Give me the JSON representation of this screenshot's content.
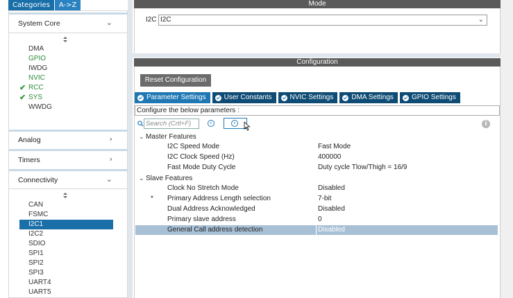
{
  "left_tabs": [
    "Categories",
    "A->Z"
  ],
  "categories": [
    {
      "label": "System Core",
      "chevron": "chevron-down-icon"
    },
    {
      "label": "Analog",
      "chevron": "chevron-right-icon"
    },
    {
      "label": "Timers",
      "chevron": "chevron-right-icon"
    },
    {
      "label": "Connectivity",
      "chevron": "chevron-down-icon"
    }
  ],
  "system_core_items": [
    {
      "label": "DMA",
      "status": "none"
    },
    {
      "label": "GPIO",
      "status": "configured"
    },
    {
      "label": "IWDG",
      "status": "none"
    },
    {
      "label": "NVIC",
      "status": "configured"
    },
    {
      "label": "RCC",
      "status": "checked"
    },
    {
      "label": "SYS",
      "status": "checked"
    },
    {
      "label": "WWDG",
      "status": "none"
    }
  ],
  "connectivity_items": [
    {
      "label": "CAN"
    },
    {
      "label": "FSMC"
    },
    {
      "label": "I2C1",
      "selected": true
    },
    {
      "label": "I2C2"
    },
    {
      "label": "SDIO"
    },
    {
      "label": "SPI1"
    },
    {
      "label": "SPI2"
    },
    {
      "label": "SPI3"
    },
    {
      "label": "UART4"
    },
    {
      "label": "UART5"
    }
  ],
  "mode": {
    "title": "Mode",
    "field_label": "I2C",
    "field_value": "I2C"
  },
  "configuration": {
    "title": "Configuration",
    "reset_label": "Reset Configuration",
    "tabs": [
      "Parameter Settings",
      "User Constants",
      "NVIC Settings",
      "DMA Settings",
      "GPIO Settings"
    ],
    "active_tab": 0,
    "description": "Configure the below parameters :",
    "search_placeholder": "Search (Crtl+F)"
  },
  "params": {
    "master_group": "Master Features",
    "master": [
      {
        "name": "I2C Speed Mode",
        "value": "Fast Mode"
      },
      {
        "name": "I2C Clock Speed (Hz)",
        "value": "400000"
      },
      {
        "name": "Fast Mode Duty Cycle",
        "value": "Duty cycle Tlow/Thigh = 16/9"
      }
    ],
    "slave_group": "Slave Features",
    "slave": [
      {
        "name": "Clock No Stretch Mode",
        "value": "Disabled",
        "star": ""
      },
      {
        "name": "Primary Address Length selection",
        "value": "7-bit",
        "star": "*"
      },
      {
        "name": "Dual Address Acknowledged",
        "value": "Disabled",
        "star": ""
      },
      {
        "name": "Primary slave address",
        "value": "0",
        "star": ""
      },
      {
        "name": "General Call address detection",
        "value": "Disabled",
        "star": "",
        "selected": true
      }
    ]
  },
  "colors": {
    "accent": "#1f78b4",
    "tab_dark": "#0f4c75",
    "configured_green": "#2a8a3a",
    "selected_row": "#a8c0d6"
  }
}
